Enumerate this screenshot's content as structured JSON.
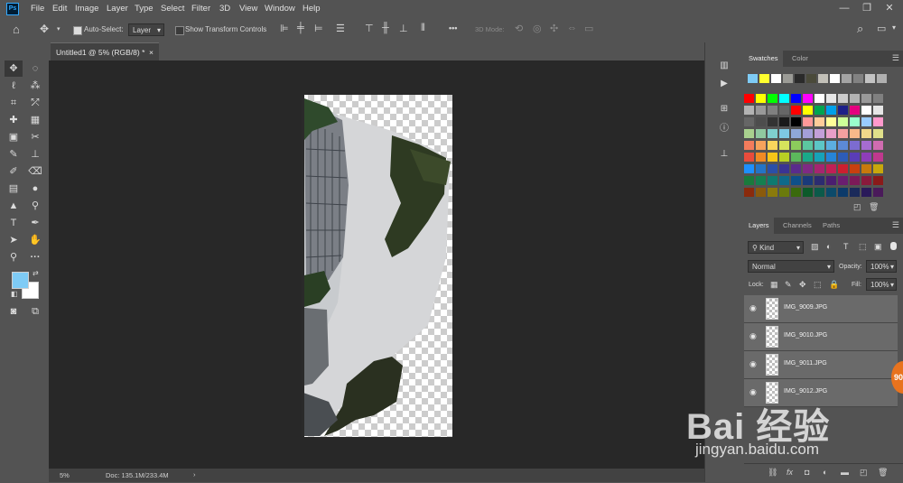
{
  "app": {
    "logo": "Ps"
  },
  "menu": [
    "File",
    "Edit",
    "Image",
    "Layer",
    "Type",
    "Select",
    "Filter",
    "3D",
    "View",
    "Window",
    "Help"
  ],
  "window_buttons": [
    "—",
    "❐",
    "✕"
  ],
  "options_bar": {
    "auto_select_label": "Auto-Select:",
    "auto_select_checked": true,
    "auto_select_target": "Layer",
    "show_transform_label": "Show Transform Controls",
    "show_transform_checked": false,
    "more_label": "•••",
    "mode_3d_label": "3D Mode:"
  },
  "document_tab": {
    "title": "Untitled1 @ 5% (RGB/8) *",
    "close": "×"
  },
  "status_bar": {
    "zoom": "5%",
    "doc_info": "Doc: 135.1M/233.4M",
    "arrow": "›"
  },
  "swatches_panel": {
    "tabs": [
      "Swatches",
      "Color"
    ],
    "active_tab": "Swatches",
    "recent": [
      "#7ecbf5",
      "#ffff2e",
      "#ffffff",
      "#9b9b96",
      "#2a2a2a",
      "#4a4a3a",
      "#c2c0b8",
      "#ffffff",
      "#a4a4a4",
      "#828282",
      "#c3c3c3",
      "#b0b0b0"
    ],
    "grid": [
      [
        "#ff0000",
        "#ffff00",
        "#00ff00",
        "#00ffff",
        "#0000ff",
        "#ff00ff",
        "#ffffff",
        "#e6e6e6",
        "#cccccc",
        "#b3b3b3",
        "#999999",
        "#808080"
      ],
      [
        "#b3b3b3",
        "#999999",
        "#808080",
        "#666666",
        "#ff0000",
        "#ffff00",
        "#00a550",
        "#00a0e9",
        "#1d2088",
        "#e4007f",
        "#ffffff",
        "#e6e6e6"
      ],
      [
        "#666666",
        "#4d4d4d",
        "#333333",
        "#1a1a1a",
        "#000000",
        "#ff9999",
        "#ffcc99",
        "#ffff99",
        "#ccff99",
        "#99ffcc",
        "#99ccff",
        "#ff99cc"
      ],
      [
        "#a9d18e",
        "#90c8a0",
        "#7fcfcf",
        "#7ec8e3",
        "#8fa8d8",
        "#a49fd8",
        "#c39fd8",
        "#e89fc8",
        "#f4a0a0",
        "#f8b98a",
        "#f0d78a",
        "#e0e08a"
      ],
      [
        "#f47c5c",
        "#f7a35c",
        "#f9d65c",
        "#d6e35c",
        "#8ccc5c",
        "#5cc6a0",
        "#5cc6c6",
        "#5caee0",
        "#5c8ad6",
        "#7c6cd0",
        "#a66cd0",
        "#d06cb0"
      ],
      [
        "#e94c3c",
        "#f08a24",
        "#f5c518",
        "#b8cf24",
        "#5cb85c",
        "#1aa889",
        "#17a2b8",
        "#2684d8",
        "#2d5cb8",
        "#5a3db8",
        "#8e3db8",
        "#c0398e"
      ],
      [
        "#1e90ff",
        "#2474c6",
        "#2a4fa8",
        "#3a3494",
        "#5a2c8c",
        "#7f2a84",
        "#a62570",
        "#c21f56",
        "#cc1f2f",
        "#c8400f",
        "#c87a0c",
        "#c8a80c"
      ],
      [
        "#1a7a3c",
        "#158050",
        "#0e7a70",
        "#0e6a8a",
        "#0e508a",
        "#1a3a7a",
        "#2c2c70",
        "#4a1e70",
        "#6a1e70",
        "#7c1a58",
        "#8a1a3c",
        "#8a1a1a"
      ],
      [
        "#8a2a0c",
        "#8a5a0c",
        "#8a7a0c",
        "#6a7a0c",
        "#3a6a0c",
        "#0c5a2a",
        "#0c5a4a",
        "#0c4a6a",
        "#0c3a6a",
        "#1a2a5a",
        "#2a1a5a",
        "#4a1a5a"
      ]
    ]
  },
  "layers_panel": {
    "tabs": [
      "Layers",
      "Channels",
      "Paths"
    ],
    "active_tab": "Layers",
    "filter_kind": "Kind",
    "blend_mode": "Normal",
    "opacity_label": "Opacity:",
    "opacity_value": "100%",
    "lock_label": "Lock:",
    "fill_label": "Fill:",
    "fill_value": "100%",
    "layers": [
      {
        "name": "IMG_9009.JPG",
        "selected": true
      },
      {
        "name": "IMG_9010.JPG",
        "selected": true
      },
      {
        "name": "IMG_9011.JPG",
        "selected": true
      },
      {
        "name": "IMG_9012.JPG",
        "selected": true
      }
    ]
  },
  "foreground_color": "#7ecbf5",
  "background_color": "#ffffff",
  "watermark": {
    "brand": "Bai  经验",
    "url": "jingyan.baidu.com"
  },
  "badge": "90"
}
